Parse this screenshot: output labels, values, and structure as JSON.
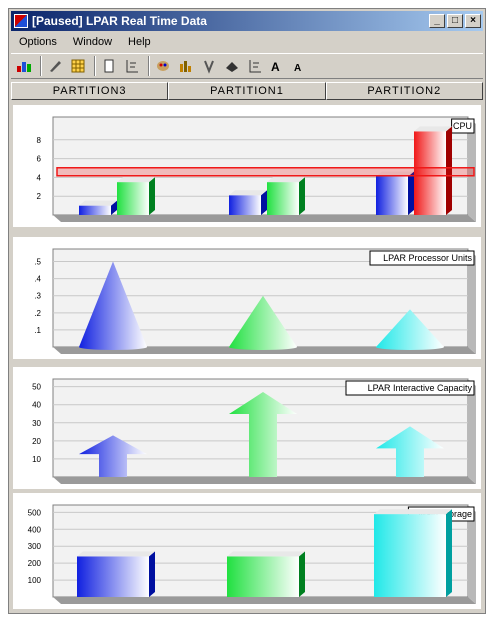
{
  "window": {
    "title": "[Paused] LPAR Real Time Data",
    "minimize": "_",
    "maximize": "□",
    "close": "×"
  },
  "menu": [
    "Options",
    "Window",
    "Help"
  ],
  "toolbar": [
    "chart-type-icon",
    "pen-icon",
    "grid-icon",
    "page-icon",
    "tree-icon",
    "palette-icon",
    "bar-chart-icon",
    "axis-icon",
    "3d-icon",
    "legend-icon",
    "font-grow-icon",
    "font-shrink-icon"
  ],
  "tabs": [
    "PARTITION3",
    "PARTITION1",
    "PARTITION2"
  ],
  "colors": {
    "blue": "#1020e0",
    "green": "#20e040",
    "red": "#f01818",
    "cyan": "#20e8e8"
  },
  "chart_data": [
    {
      "type": "bar",
      "title": "CPU",
      "categories": [
        "PARTITION3",
        "PARTITION1",
        "PARTITION2"
      ],
      "yticks": [
        "2",
        "4",
        "6",
        "8"
      ],
      "ylim": [
        0,
        10
      ],
      "threshold": 4.6,
      "series": [
        {
          "values": [
            1,
            2.1,
            4.1
          ]
        },
        {
          "values": [
            3.5,
            3.5,
            8.9
          ]
        }
      ]
    },
    {
      "type": "bar",
      "title": "LPAR Processor Units",
      "categories": [
        "PARTITION3",
        "PARTITION1",
        "PARTITION2"
      ],
      "yticks": [
        ".1",
        ".2",
        ".3",
        ".4",
        ".5"
      ],
      "ylim": [
        0,
        0.55
      ],
      "values": [
        0.5,
        0.3,
        0.22
      ]
    },
    {
      "type": "bar",
      "title": "LPAR Interactive Capacity",
      "categories": [
        "PARTITION3",
        "PARTITION1",
        "PARTITION2"
      ],
      "yticks": [
        "10",
        "20",
        "30",
        "40",
        "50"
      ],
      "ylim": [
        0,
        52
      ],
      "values": [
        23,
        47,
        28
      ]
    },
    {
      "type": "bar",
      "title": "Main Storage",
      "categories": [
        "PARTITION3",
        "PARTITION1",
        "PARTITION2"
      ],
      "yticks": [
        "100",
        "200",
        "300",
        "400",
        "500"
      ],
      "ylim": [
        0,
        520
      ],
      "values": [
        240,
        240,
        490
      ]
    }
  ]
}
